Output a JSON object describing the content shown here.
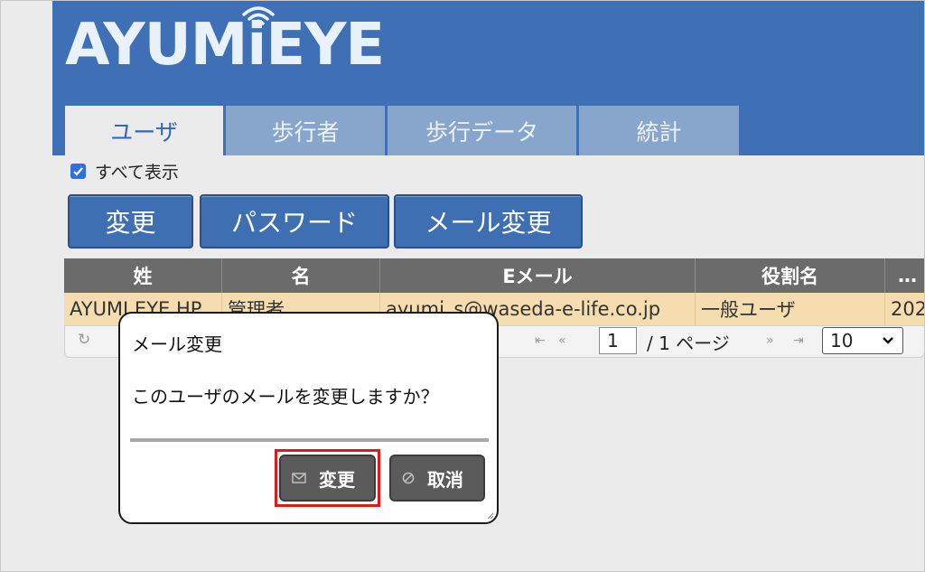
{
  "app": {
    "logo_text": "AYUMiEYE",
    "header_color": "#3f6fb5"
  },
  "tabs": [
    {
      "label": "ユーザ",
      "active": true
    },
    {
      "label": "歩行者",
      "active": false
    },
    {
      "label": "歩行データ",
      "active": false
    },
    {
      "label": "統計",
      "active": false
    }
  ],
  "filter": {
    "show_all_label": "すべて表示",
    "show_all_checked": true
  },
  "actions": {
    "change": "変更",
    "password": "パスワード",
    "email_change": "メール変更"
  },
  "grid": {
    "columns": [
      "姓",
      "名",
      "Eメール",
      "役割名",
      "…"
    ],
    "rows": [
      {
        "last_name": "AYUMI EYE HP",
        "first_name": "管理者",
        "email": "ayumi_s@waseda-e-life.co.jp",
        "role": "一般ユーザ",
        "extra": "202"
      }
    ],
    "pager": {
      "refresh_icon": "refresh-icon",
      "page": "1",
      "total_pages_text": "/ 1 ページ",
      "rows_per_page": "10"
    }
  },
  "dialog": {
    "title": "メール変更",
    "message": "このユーザのメールを変更しますか？",
    "confirm_label": "変更",
    "cancel_label": "取消",
    "confirm_icon": "envelope-icon",
    "cancel_icon": "ban-icon",
    "highlight_color": "#e01818"
  }
}
